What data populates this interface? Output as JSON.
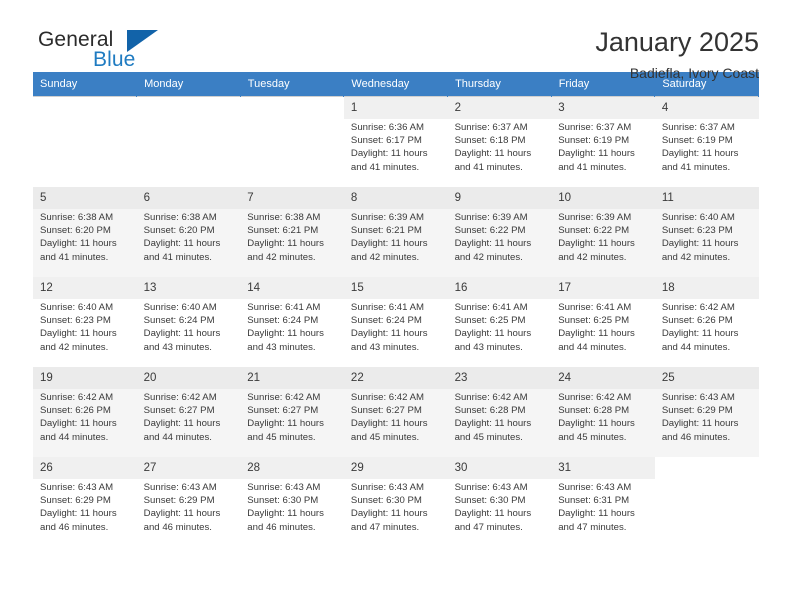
{
  "brand": {
    "name_top": "General",
    "name_bottom": "Blue",
    "logo_icon": "triangle-logo-icon",
    "accent_color": "#1263a9"
  },
  "header": {
    "title": "January 2025",
    "subtitle": "Badiefla, Ivory Coast"
  },
  "calendar": {
    "header_bg": "#3b7fc4",
    "weekdays": [
      "Sunday",
      "Monday",
      "Tuesday",
      "Wednesday",
      "Thursday",
      "Friday",
      "Saturday"
    ],
    "weeks": [
      [
        {
          "day": "",
          "lines": []
        },
        {
          "day": "",
          "lines": []
        },
        {
          "day": "",
          "lines": []
        },
        {
          "day": "1",
          "lines": [
            "Sunrise: 6:36 AM",
            "Sunset: 6:17 PM",
            "Daylight: 11 hours",
            "and 41 minutes."
          ]
        },
        {
          "day": "2",
          "lines": [
            "Sunrise: 6:37 AM",
            "Sunset: 6:18 PM",
            "Daylight: 11 hours",
            "and 41 minutes."
          ]
        },
        {
          "day": "3",
          "lines": [
            "Sunrise: 6:37 AM",
            "Sunset: 6:19 PM",
            "Daylight: 11 hours",
            "and 41 minutes."
          ]
        },
        {
          "day": "4",
          "lines": [
            "Sunrise: 6:37 AM",
            "Sunset: 6:19 PM",
            "Daylight: 11 hours",
            "and 41 minutes."
          ]
        }
      ],
      [
        {
          "day": "5",
          "lines": [
            "Sunrise: 6:38 AM",
            "Sunset: 6:20 PM",
            "Daylight: 11 hours",
            "and 41 minutes."
          ]
        },
        {
          "day": "6",
          "lines": [
            "Sunrise: 6:38 AM",
            "Sunset: 6:20 PM",
            "Daylight: 11 hours",
            "and 41 minutes."
          ]
        },
        {
          "day": "7",
          "lines": [
            "Sunrise: 6:38 AM",
            "Sunset: 6:21 PM",
            "Daylight: 11 hours",
            "and 42 minutes."
          ]
        },
        {
          "day": "8",
          "lines": [
            "Sunrise: 6:39 AM",
            "Sunset: 6:21 PM",
            "Daylight: 11 hours",
            "and 42 minutes."
          ]
        },
        {
          "day": "9",
          "lines": [
            "Sunrise: 6:39 AM",
            "Sunset: 6:22 PM",
            "Daylight: 11 hours",
            "and 42 minutes."
          ]
        },
        {
          "day": "10",
          "lines": [
            "Sunrise: 6:39 AM",
            "Sunset: 6:22 PM",
            "Daylight: 11 hours",
            "and 42 minutes."
          ]
        },
        {
          "day": "11",
          "lines": [
            "Sunrise: 6:40 AM",
            "Sunset: 6:23 PM",
            "Daylight: 11 hours",
            "and 42 minutes."
          ]
        }
      ],
      [
        {
          "day": "12",
          "lines": [
            "Sunrise: 6:40 AM",
            "Sunset: 6:23 PM",
            "Daylight: 11 hours",
            "and 42 minutes."
          ]
        },
        {
          "day": "13",
          "lines": [
            "Sunrise: 6:40 AM",
            "Sunset: 6:24 PM",
            "Daylight: 11 hours",
            "and 43 minutes."
          ]
        },
        {
          "day": "14",
          "lines": [
            "Sunrise: 6:41 AM",
            "Sunset: 6:24 PM",
            "Daylight: 11 hours",
            "and 43 minutes."
          ]
        },
        {
          "day": "15",
          "lines": [
            "Sunrise: 6:41 AM",
            "Sunset: 6:24 PM",
            "Daylight: 11 hours",
            "and 43 minutes."
          ]
        },
        {
          "day": "16",
          "lines": [
            "Sunrise: 6:41 AM",
            "Sunset: 6:25 PM",
            "Daylight: 11 hours",
            "and 43 minutes."
          ]
        },
        {
          "day": "17",
          "lines": [
            "Sunrise: 6:41 AM",
            "Sunset: 6:25 PM",
            "Daylight: 11 hours",
            "and 44 minutes."
          ]
        },
        {
          "day": "18",
          "lines": [
            "Sunrise: 6:42 AM",
            "Sunset: 6:26 PM",
            "Daylight: 11 hours",
            "and 44 minutes."
          ]
        }
      ],
      [
        {
          "day": "19",
          "lines": [
            "Sunrise: 6:42 AM",
            "Sunset: 6:26 PM",
            "Daylight: 11 hours",
            "and 44 minutes."
          ]
        },
        {
          "day": "20",
          "lines": [
            "Sunrise: 6:42 AM",
            "Sunset: 6:27 PM",
            "Daylight: 11 hours",
            "and 44 minutes."
          ]
        },
        {
          "day": "21",
          "lines": [
            "Sunrise: 6:42 AM",
            "Sunset: 6:27 PM",
            "Daylight: 11 hours",
            "and 45 minutes."
          ]
        },
        {
          "day": "22",
          "lines": [
            "Sunrise: 6:42 AM",
            "Sunset: 6:27 PM",
            "Daylight: 11 hours",
            "and 45 minutes."
          ]
        },
        {
          "day": "23",
          "lines": [
            "Sunrise: 6:42 AM",
            "Sunset: 6:28 PM",
            "Daylight: 11 hours",
            "and 45 minutes."
          ]
        },
        {
          "day": "24",
          "lines": [
            "Sunrise: 6:42 AM",
            "Sunset: 6:28 PM",
            "Daylight: 11 hours",
            "and 45 minutes."
          ]
        },
        {
          "day": "25",
          "lines": [
            "Sunrise: 6:43 AM",
            "Sunset: 6:29 PM",
            "Daylight: 11 hours",
            "and 46 minutes."
          ]
        }
      ],
      [
        {
          "day": "26",
          "lines": [
            "Sunrise: 6:43 AM",
            "Sunset: 6:29 PM",
            "Daylight: 11 hours",
            "and 46 minutes."
          ]
        },
        {
          "day": "27",
          "lines": [
            "Sunrise: 6:43 AM",
            "Sunset: 6:29 PM",
            "Daylight: 11 hours",
            "and 46 minutes."
          ]
        },
        {
          "day": "28",
          "lines": [
            "Sunrise: 6:43 AM",
            "Sunset: 6:30 PM",
            "Daylight: 11 hours",
            "and 46 minutes."
          ]
        },
        {
          "day": "29",
          "lines": [
            "Sunrise: 6:43 AM",
            "Sunset: 6:30 PM",
            "Daylight: 11 hours",
            "and 47 minutes."
          ]
        },
        {
          "day": "30",
          "lines": [
            "Sunrise: 6:43 AM",
            "Sunset: 6:30 PM",
            "Daylight: 11 hours",
            "and 47 minutes."
          ]
        },
        {
          "day": "31",
          "lines": [
            "Sunrise: 6:43 AM",
            "Sunset: 6:31 PM",
            "Daylight: 11 hours",
            "and 47 minutes."
          ]
        },
        {
          "day": "",
          "lines": []
        }
      ]
    ]
  }
}
